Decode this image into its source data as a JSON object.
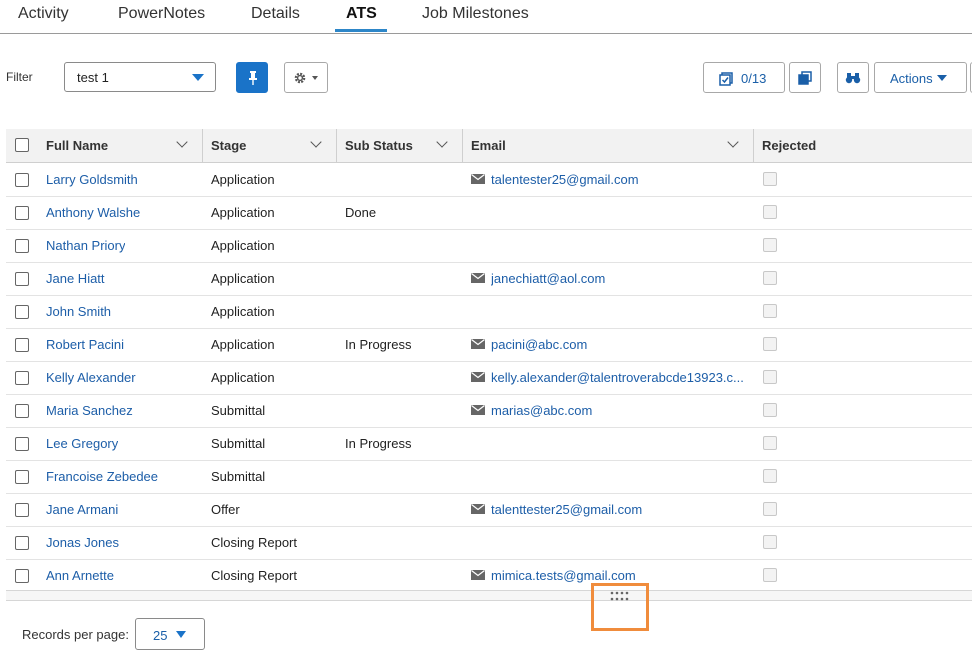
{
  "tabs": [
    {
      "label": "Activity"
    },
    {
      "label": "PowerNotes"
    },
    {
      "label": "Details"
    },
    {
      "label": "ATS",
      "active": true
    },
    {
      "label": "Job Milestones"
    }
  ],
  "toolbar": {
    "filter_label": "Filter",
    "filter_value": "test 1",
    "pin_icon": "pin-icon",
    "settings_icon": "gear-icon",
    "selection_count": "0/13",
    "actions_label": "Actions"
  },
  "table": {
    "columns": [
      "Full Name",
      "Stage",
      "Sub Status",
      "Email",
      "Rejected"
    ],
    "rows": [
      {
        "name": "Larry Goldsmith",
        "stage": "Application",
        "sub_status": "",
        "email": "talentester25@gmail.com"
      },
      {
        "name": "Anthony Walshe",
        "stage": "Application",
        "sub_status": "Done",
        "email": ""
      },
      {
        "name": "Nathan Priory",
        "stage": "Application",
        "sub_status": "",
        "email": ""
      },
      {
        "name": "Jane Hiatt",
        "stage": "Application",
        "sub_status": "",
        "email": "janechiatt@aol.com"
      },
      {
        "name": "John Smith",
        "stage": "Application",
        "sub_status": "",
        "email": ""
      },
      {
        "name": "Robert Pacini",
        "stage": "Application",
        "sub_status": "In Progress",
        "email": "pacini@abc.com"
      },
      {
        "name": "Kelly Alexander",
        "stage": "Application",
        "sub_status": "",
        "email": "kelly.alexander@talentroverabcde13923.c..."
      },
      {
        "name": "Maria Sanchez",
        "stage": "Submittal",
        "sub_status": "",
        "email": "marias@abc.com"
      },
      {
        "name": "Lee Gregory",
        "stage": "Submittal",
        "sub_status": "In Progress",
        "email": ""
      },
      {
        "name": "Francoise Zebedee",
        "stage": "Submittal",
        "sub_status": "",
        "email": ""
      },
      {
        "name": "Jane Armani",
        "stage": "Offer",
        "sub_status": "",
        "email": "talenttester25@gmail.com"
      },
      {
        "name": "Jonas Jones",
        "stage": "Closing Report",
        "sub_status": "",
        "email": ""
      },
      {
        "name": "Ann Arnette",
        "stage": "Closing Report",
        "sub_status": "",
        "email": "mimica.tests@gmail.com"
      }
    ]
  },
  "pagination": {
    "records_label": "Records per page:",
    "records_value": "25"
  },
  "colors": {
    "accent": "#1a73c8",
    "link": "#1d5ea8",
    "highlight": "#f08c3c"
  }
}
